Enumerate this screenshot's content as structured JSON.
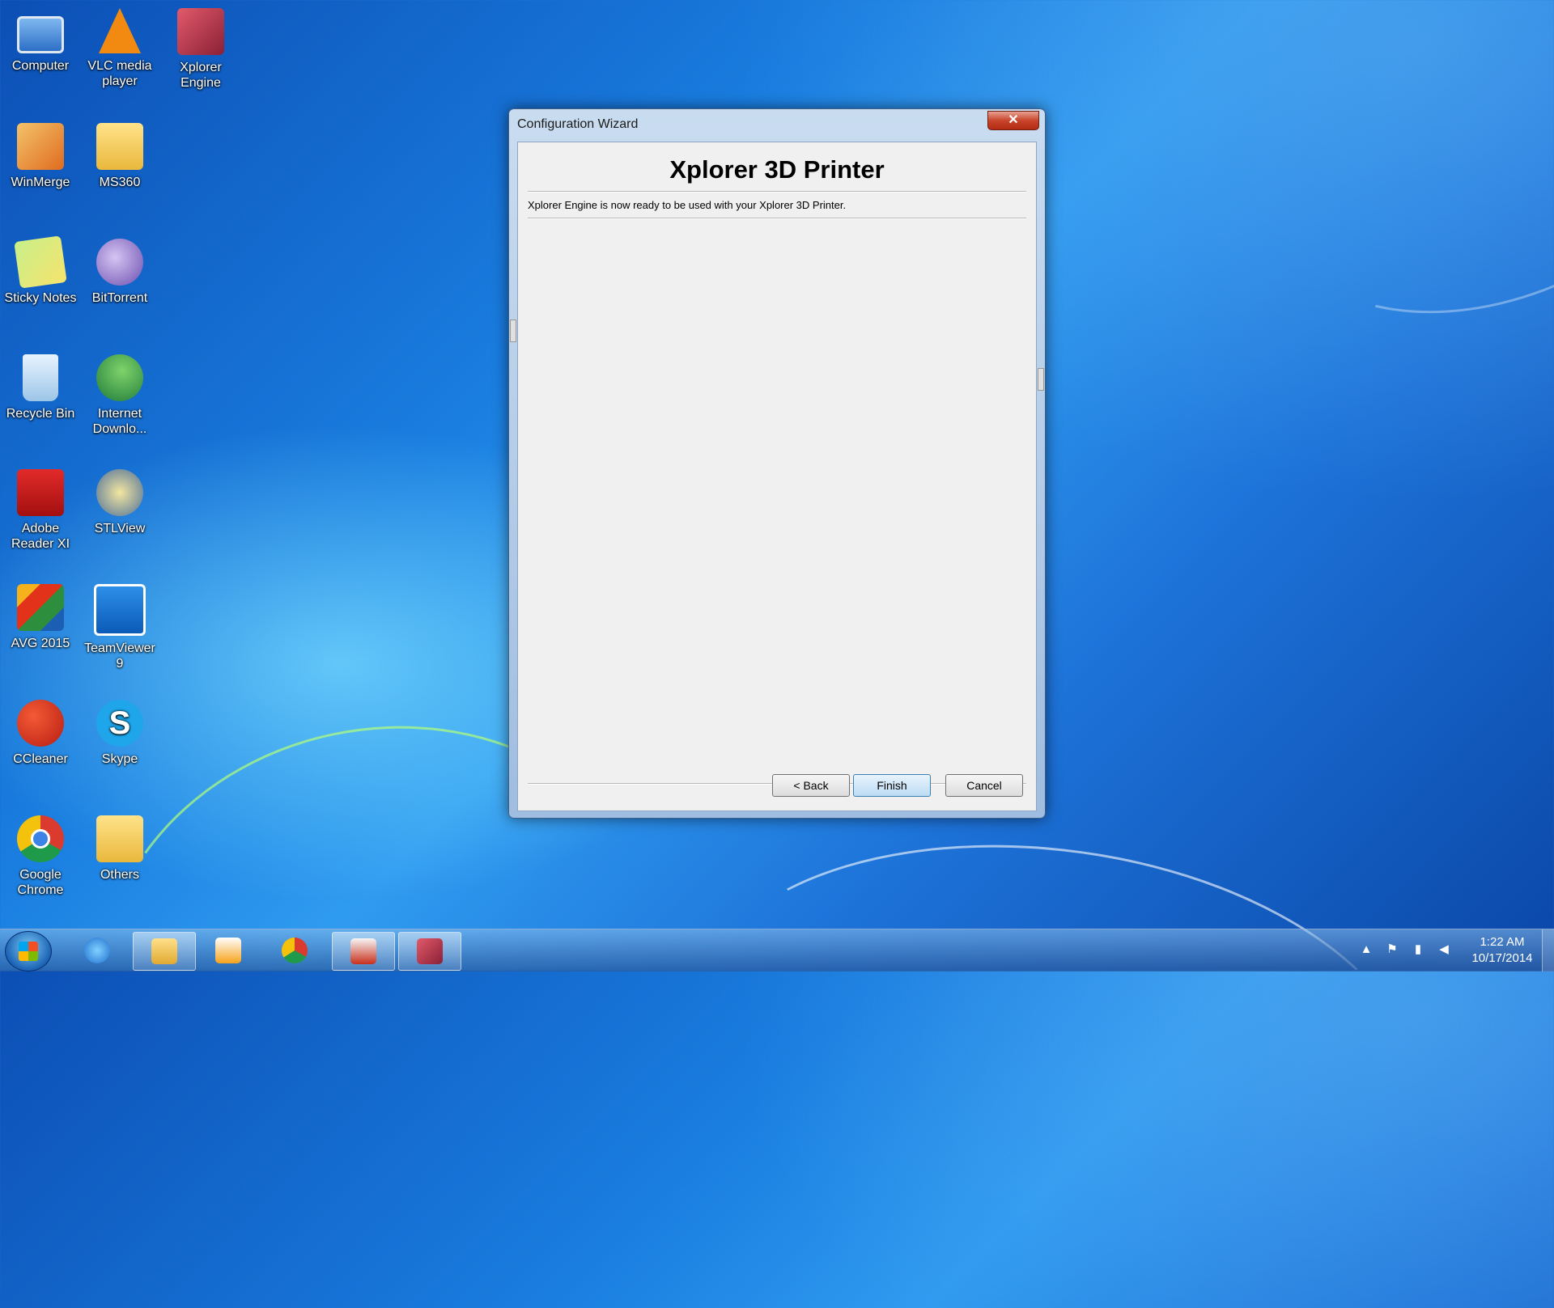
{
  "desktop": {
    "icons": [
      {
        "label": "Computer"
      },
      {
        "label": "VLC media player"
      },
      {
        "label": "Xplorer Engine"
      },
      {
        "label": "WinMerge"
      },
      {
        "label": "MS360"
      },
      {
        "label": "Sticky Notes"
      },
      {
        "label": "BitTorrent"
      },
      {
        "label": "Recycle Bin"
      },
      {
        "label": "Internet Downlo..."
      },
      {
        "label": "Adobe Reader XI"
      },
      {
        "label": "STLView"
      },
      {
        "label": "AVG 2015"
      },
      {
        "label": "TeamViewer 9"
      },
      {
        "label": "CCleaner"
      },
      {
        "label": "Skype"
      },
      {
        "label": "Google Chrome"
      },
      {
        "label": "Others"
      }
    ]
  },
  "dialog": {
    "title": "Configuration Wizard",
    "close_label": "✕",
    "heading": "Xplorer 3D Printer",
    "message": "Xplorer Engine is now ready to be used with your Xplorer 3D Printer.",
    "buttons": {
      "back": "< Back",
      "finish": "Finish",
      "cancel": "Cancel"
    }
  },
  "taskbar": {
    "tray": {
      "arrow": "▲",
      "flag": "⚑",
      "signal": "▮",
      "volume": "◀"
    },
    "clock": {
      "time": "1:22 AM",
      "date": "10/17/2014"
    }
  },
  "skype_glyph": "S"
}
